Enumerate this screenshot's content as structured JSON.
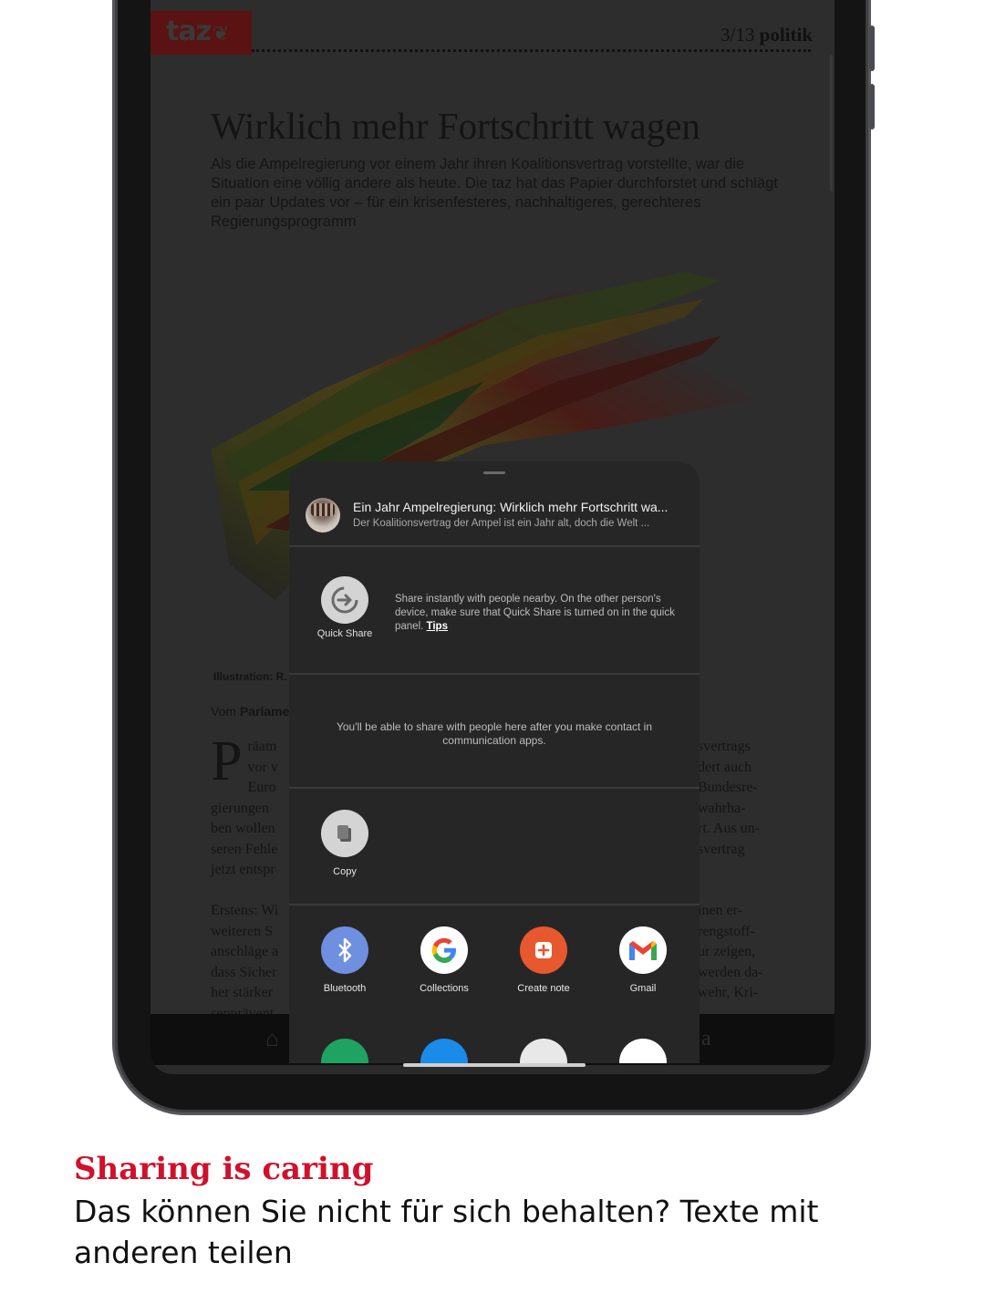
{
  "article": {
    "logo": "taz",
    "page_number": "3/13",
    "section": "politik",
    "headline": "Wirklich mehr Fortschritt wagen",
    "teaser": "Als die Ampelregierung vor einem Jahr ihren Koalitionsvertrag vorstellte, war die Situation eine völlig andere als heute. Die taz hat das Papier durchforstet und schlägt ein paar Updates vor – für ein krisenfesteres, nachhaltigeres, gerechteres Regierungsprogramm",
    "caption": "Illustration: R.",
    "byline_prefix": "Vom",
    "byline_name": "Parlame",
    "dropcap": "P",
    "body_left": [
      "räam",
      "vor v",
      "Euro",
      "gierungen",
      "ben wollen",
      "seren Fehle",
      "jetzt entspr",
      "",
      "Erstens: Wi",
      "weiteren S",
      "anschläge a",
      "dass Sicher",
      "her stärker",
      "senprävent"
    ],
    "body_right": [
      "svertrags",
      "dert auch",
      "Bundesre-",
      "wahrha-",
      "rt. Aus un-",
      "svertrag",
      "",
      "",
      "inen er-",
      "rengstoff-",
      "ur zeigen,",
      "werden da-",
      "wehr, Kri-",
      ""
    ]
  },
  "share_sheet": {
    "preview_title": "Ein Jahr Ampelregierung: Wirklich mehr Fortschritt wa...",
    "preview_subtitle": "Der Koalitionsvertrag der Ampel ist ein Jahr alt, doch die Welt ...",
    "quick_share": {
      "label": "Quick Share",
      "description": "Share instantly with people nearby. On the other person's device, make sure that Quick Share is turned on in the quick panel.",
      "tips": "Tips"
    },
    "contacts_message": "You'll be able to share with people here after you make contact in communication apps.",
    "copy_label": "Copy",
    "apps": [
      {
        "label": "Bluetooth",
        "icon": "bluetooth-icon",
        "color": "#6f8fe0"
      },
      {
        "label": "Collections",
        "icon": "google-icon",
        "color": "#ffffff"
      },
      {
        "label": "Create note",
        "icon": "create-note-icon",
        "color": "#e8582e"
      },
      {
        "label": "Gmail",
        "icon": "gmail-icon",
        "color": "#ffffff"
      }
    ]
  },
  "promo": {
    "title": "Sharing is caring",
    "subtitle": "Das können Sie nicht für sich behalten? Texte mit anderen teilen",
    "title_color": "#d0112b"
  }
}
